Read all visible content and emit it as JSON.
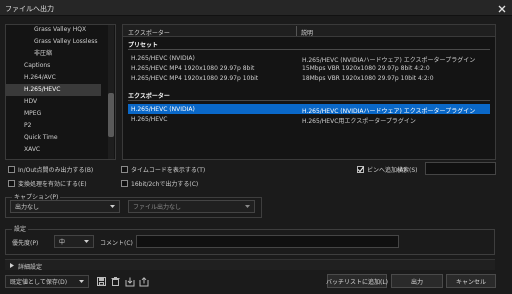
{
  "window": {
    "title": "ファイルへ出力"
  },
  "left_list": {
    "items": [
      {
        "label": "Grass Valley HQX",
        "indent": true
      },
      {
        "label": "Grass Valley Lossless",
        "indent": true
      },
      {
        "label": "非圧縮",
        "indent": true
      },
      {
        "label": "Captions",
        "indent": false
      },
      {
        "label": "H.264/AVC",
        "indent": false
      },
      {
        "label": "H.265/HEVC",
        "indent": false,
        "selected": true
      },
      {
        "label": "HDV",
        "indent": false
      },
      {
        "label": "MPEG",
        "indent": false
      },
      {
        "label": "P2",
        "indent": false
      },
      {
        "label": "Quick Time",
        "indent": false
      },
      {
        "label": "XAVC",
        "indent": false
      }
    ]
  },
  "right_list": {
    "col_exporter": "エクスポーター",
    "col_desc": "説明",
    "preset_section": "プリセット",
    "exporter_section": "エクスポーター",
    "presets": [
      {
        "name": "H.265/HEVC (NVIDIA)",
        "desc": "H.265/HEVC (NVIDIAハードウェア) エクスポータープラグイン"
      },
      {
        "name": "H.265/HEVC MP4 1920x1080 29.97p 8bit",
        "desc": "15Mbps VBR 1920x1080 29.97p 8bit 4:2:0"
      },
      {
        "name": "H.265/HEVC MP4 1920x1080 29.97p 10bit",
        "desc": "18Mbps VBR 1920x1080 29.97p 10bit 4:2:0"
      }
    ],
    "exporters": [
      {
        "name": "H.265/HEVC (NVIDIA)",
        "desc": "H.265/HEVC (NVIDIAハードウェア) エクスポータープラグイン",
        "selected": true
      },
      {
        "name": "H.265/HEVC",
        "desc": "H.265/HEVC用エクスポータープラグイン"
      }
    ]
  },
  "options": {
    "inout": "In/Out点間のみ出力する(B)",
    "timecode": "タイムコードを表示する(T)",
    "bin_add": "ビンへ追加(A)",
    "search_label": "検索(S)",
    "convert": "変換処理を有効にする(E)",
    "bit16": "16bit/2chで出力する(C)"
  },
  "caption": {
    "label": "キャプション(P)",
    "select1": "出力なし",
    "select2": "ファイル出力なし"
  },
  "settings": {
    "label": "設定",
    "priority_label": "優先度(P)",
    "priority_value": "中",
    "comment_label": "コメント(C)"
  },
  "detail": {
    "label": "詳細設定"
  },
  "footer": {
    "save_label": "既定値として保存(D)",
    "batch_label": "バッチリストに追加(L)",
    "output_label": "出力",
    "cancel_label": "キャンセル"
  },
  "colors": {
    "selection": "#0a68c8",
    "background": "#1b1b1b"
  }
}
